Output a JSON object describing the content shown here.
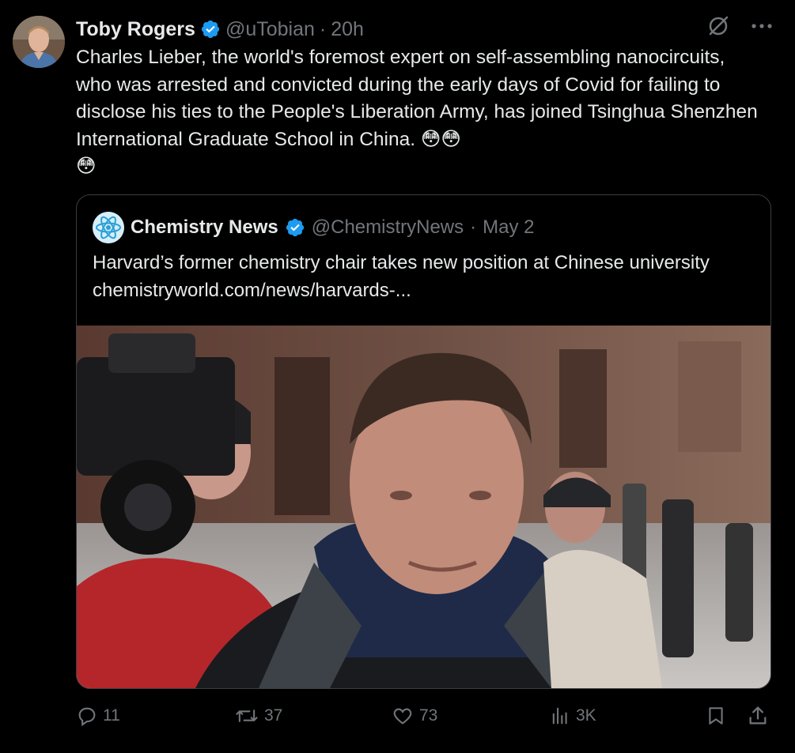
{
  "tweet": {
    "author_name": "Toby Rogers",
    "handle": "@uTobian",
    "separator": "·",
    "time": "20h",
    "text": "Charles Lieber, the world's foremost expert on self-assembling nanocircuits, who was arrested and convicted during the early days of Covid for failing to disclose his ties to the People's Liberation Army, has joined Tsinghua Shenzhen International Graduate School in China. 😳😳\n😳"
  },
  "quoted": {
    "author_name": "Chemistry News",
    "handle": "@ChemistryNews",
    "separator": "·",
    "time": "May 2",
    "text": "Harvard’s former chemistry chair takes new position at Chinese university chemistryworld.com/news/harvards-..."
  },
  "actions": {
    "replies": "11",
    "reposts": "37",
    "likes": "73",
    "views": "3K"
  },
  "icons": {
    "verified": "verified-badge-icon",
    "grok": "grok-icon",
    "more": "more-icon",
    "reply": "reply-icon",
    "repost": "repost-icon",
    "like": "like-icon",
    "views": "views-icon",
    "bookmark": "bookmark-icon",
    "share": "share-icon"
  },
  "colors": {
    "background": "#000000",
    "text": "#e7e9ea",
    "secondary": "#71767b",
    "verified": "#1d9bf0",
    "border": "#3a3d41"
  }
}
